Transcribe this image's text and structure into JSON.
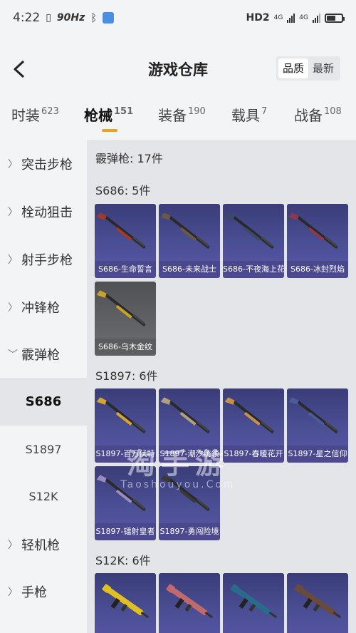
{
  "status": {
    "time": "4:22",
    "refresh": "90Hz",
    "network": "HD2",
    "sig1": "4G",
    "sig2": "4G"
  },
  "header": {
    "title": "游戏仓库",
    "sort_quality": "品质",
    "sort_latest": "最新"
  },
  "tabs": [
    {
      "label": "时装",
      "count": "623"
    },
    {
      "label": "枪械",
      "count": "151"
    },
    {
      "label": "装备",
      "count": "190"
    },
    {
      "label": "载具",
      "count": "7"
    },
    {
      "label": "战备",
      "count": "108"
    }
  ],
  "sidebar": {
    "items": [
      "突击步枪",
      "栓动狙击",
      "射手步枪",
      "冲锋枪",
      "霰弹枪",
      "轻机枪",
      "手枪"
    ],
    "subs": [
      "S686",
      "S1897",
      "S12K"
    ]
  },
  "content": {
    "category_title": "霰弹枪: 17件",
    "groups": [
      {
        "title": "S686: 5件",
        "cards": [
          "S686-生命誓言",
          "S686-未来战士",
          "S686-不夜海上花",
          "S686-冰封烈焰",
          "S686-乌木金纹"
        ]
      },
      {
        "title": "S1897: 6件",
        "cards": [
          "S1897-百万伏特",
          "S1897-潮汐统领",
          "S1897-春暖花开",
          "S1897-星之信仰",
          "S1897-镭射皇者",
          "S1897-勇闯险境"
        ]
      },
      {
        "title": "S12K: 6件",
        "cards": [
          "",
          "",
          "",
          ""
        ]
      }
    ]
  },
  "watermark": {
    "big": "淘手游",
    "small": "Taoshouyou.Com"
  },
  "colors": {
    "accent": "#f0a020",
    "card_purple": "#4b4f95",
    "card_gray": "#616366"
  }
}
